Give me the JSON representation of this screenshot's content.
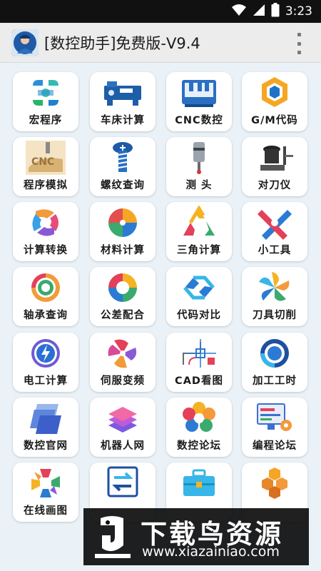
{
  "status_bar": {
    "time": "3:23",
    "icons": [
      "wifi-icon",
      "signal-icon",
      "battery-icon"
    ]
  },
  "app_bar": {
    "title": "[数控助手]免费版-V9.4",
    "menu_icon": "overflow-menu-icon"
  },
  "tiles": [
    {
      "label": "宏程序",
      "icon": "macro-program-icon"
    },
    {
      "label": "车床计算",
      "icon": "lathe-calc-icon"
    },
    {
      "label": "CNC数控",
      "icon": "cnc-machine-icon"
    },
    {
      "label": "G/M代码",
      "icon": "gm-code-icon"
    },
    {
      "label": "程序模拟",
      "icon": "program-sim-icon"
    },
    {
      "label": "螺纹查询",
      "icon": "thread-query-icon"
    },
    {
      "label": "测 头",
      "icon": "probe-icon"
    },
    {
      "label": "对刀仪",
      "icon": "tool-setter-icon"
    },
    {
      "label": "计算转换",
      "icon": "calc-convert-icon"
    },
    {
      "label": "材料计算",
      "icon": "material-calc-icon"
    },
    {
      "label": "三角计算",
      "icon": "triangle-calc-icon"
    },
    {
      "label": "小工具",
      "icon": "small-tools-icon"
    },
    {
      "label": "轴承查询",
      "icon": "bearing-query-icon"
    },
    {
      "label": "公差配合",
      "icon": "tolerance-fit-icon"
    },
    {
      "label": "代码对比",
      "icon": "code-compare-icon"
    },
    {
      "label": "刀具切削",
      "icon": "tool-cutting-icon"
    },
    {
      "label": "电工计算",
      "icon": "electric-calc-icon"
    },
    {
      "label": "伺服变频",
      "icon": "servo-inverter-icon"
    },
    {
      "label": "CAD看图",
      "icon": "cad-viewer-icon"
    },
    {
      "label": "加工工时",
      "icon": "machining-hours-icon"
    },
    {
      "label": "数控官网",
      "icon": "cnc-website-icon"
    },
    {
      "label": "机器人网",
      "icon": "robot-net-icon"
    },
    {
      "label": "数控论坛",
      "icon": "cnc-forum-icon"
    },
    {
      "label": "编程论坛",
      "icon": "programming-forum-icon"
    },
    {
      "label": "在线画图",
      "icon": "online-drawing-icon"
    },
    {
      "label": "",
      "icon": "online-translate-icon"
    },
    {
      "label": "",
      "icon": "toolbox-icon"
    },
    {
      "label": "",
      "icon": "hexagon-icon"
    }
  ],
  "watermark": {
    "title": "下载鸟资源",
    "url": "www.xiazainiao.com"
  },
  "colors": {
    "page_bg": "#eaf2f8",
    "app_bar_bg": "#ececec",
    "status_bar_bg": "#111111",
    "tile_bg": "#ffffff"
  }
}
